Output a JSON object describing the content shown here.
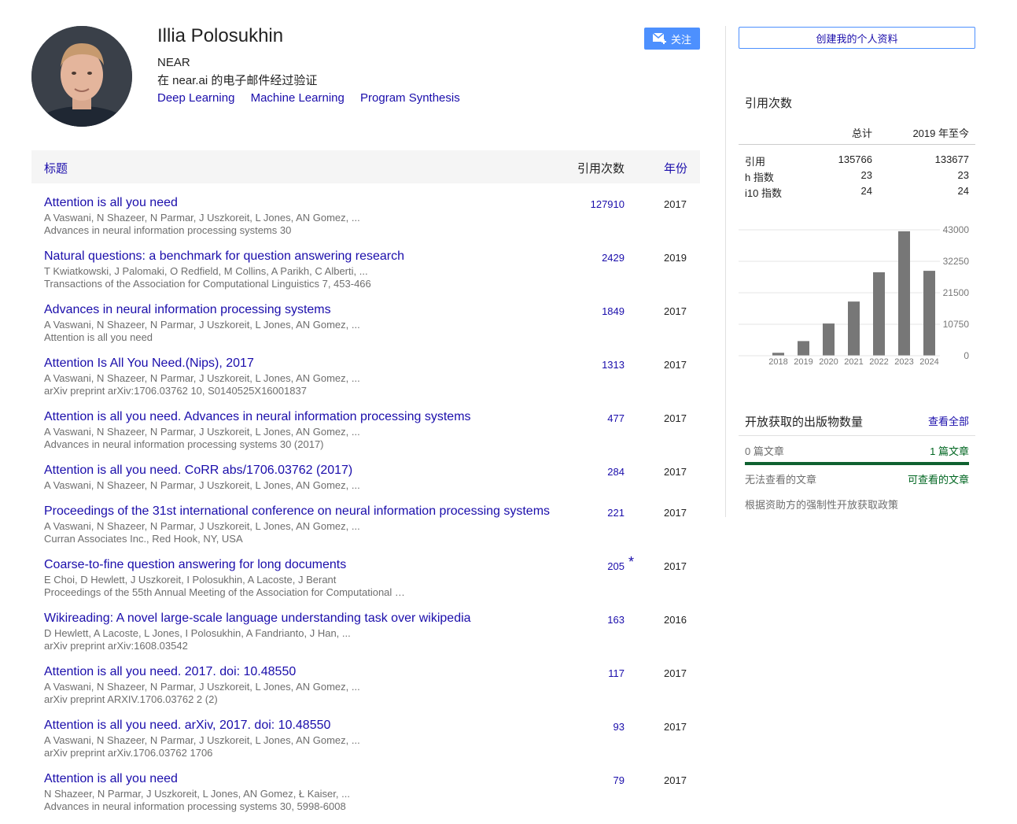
{
  "profile": {
    "name": "Illia Polosukhin",
    "affiliation": "NEAR",
    "email_verified": "在 near.ai 的电子邮件经过验证",
    "interests": [
      "Deep Learning",
      "Machine Learning",
      "Program Synthesis"
    ],
    "follow_label": "关注",
    "icons": {
      "follow": "mail-plus-icon",
      "avatar": "profile-photo"
    }
  },
  "table": {
    "header": {
      "title": "标题",
      "cites": "引用次数",
      "year": "年份"
    },
    "articles": [
      {
        "title": "Attention is all you need",
        "authors": "A Vaswani, N Shazeer, N Parmar, J Uszkoreit, L Jones, AN Gomez, ...",
        "venue": "Advances in neural information processing systems 30",
        "cites": "127910",
        "year": "2017",
        "star": ""
      },
      {
        "title": "Natural questions: a benchmark for question answering research",
        "authors": "T Kwiatkowski, J Palomaki, O Redfield, M Collins, A Parikh, C Alberti, ...",
        "venue": "Transactions of the Association for Computational Linguistics 7, 453-466",
        "cites": "2429",
        "year": "2019",
        "star": ""
      },
      {
        "title": "Advances in neural information processing systems",
        "authors": "A Vaswani, N Shazeer, N Parmar, J Uszkoreit, L Jones, AN Gomez, ...",
        "venue": "Attention is all you need",
        "cites": "1849",
        "year": "2017",
        "star": ""
      },
      {
        "title": "Attention Is All You Need.(Nips), 2017",
        "authors": "A Vaswani, N Shazeer, N Parmar, J Uszkoreit, L Jones, AN Gomez, ...",
        "venue": "arXiv preprint arXiv:1706.03762 10, S0140525X16001837",
        "cites": "1313",
        "year": "2017",
        "star": ""
      },
      {
        "title": "Attention is all you need. Advances in neural information processing systems",
        "authors": "A Vaswani, N Shazeer, N Parmar, J Uszkoreit, L Jones, AN Gomez, ...",
        "venue": "Advances in neural information processing systems 30 (2017)",
        "cites": "477",
        "year": "2017",
        "star": ""
      },
      {
        "title": "Attention is all you need. CoRR abs/1706.03762 (2017)",
        "authors": "A Vaswani, N Shazeer, N Parmar, J Uszkoreit, L Jones, AN Gomez, ...",
        "venue": "",
        "cites": "284",
        "year": "2017",
        "star": ""
      },
      {
        "title": "Proceedings of the 31st international conference on neural information processing systems",
        "authors": "A Vaswani, N Shazeer, N Parmar, J Uszkoreit, L Jones, AN Gomez, ...",
        "venue": "Curran Associates Inc., Red Hook, NY, USA",
        "cites": "221",
        "year": "2017",
        "star": ""
      },
      {
        "title": "Coarse-to-fine question answering for long documents",
        "authors": "E Choi, D Hewlett, J Uszkoreit, I Polosukhin, A Lacoste, J Berant",
        "venue": "Proceedings of the 55th Annual Meeting of the Association for Computational …",
        "cites": "205",
        "year": "2017",
        "star": "*"
      },
      {
        "title": "Wikireading: A novel large-scale language understanding task over wikipedia",
        "authors": "D Hewlett, A Lacoste, L Jones, I Polosukhin, A Fandrianto, J Han, ...",
        "venue": "arXiv preprint arXiv:1608.03542",
        "cites": "163",
        "year": "2016",
        "star": ""
      },
      {
        "title": "Attention is all you need. 2017. doi: 10.48550",
        "authors": "A Vaswani, N Shazeer, N Parmar, J Uszkoreit, L Jones, AN Gomez, ...",
        "venue": "arXiv preprint ARXIV.1706.03762 2 (2)",
        "cites": "117",
        "year": "2017",
        "star": ""
      },
      {
        "title": "Attention is all you need. arXiv, 2017. doi: 10.48550",
        "authors": "A Vaswani, N Shazeer, N Parmar, J Uszkoreit, L Jones, AN Gomez, ...",
        "venue": "arXiv preprint arXiv.1706.03762 1706",
        "cites": "93",
        "year": "2017",
        "star": ""
      },
      {
        "title": "Attention is all you need",
        "authors": "N Shazeer, N Parmar, J Uszkoreit, L Jones, AN Gomez, Ł Kaiser, ...",
        "venue": "Advances in neural information processing systems 30, 5998-6008",
        "cites": "79",
        "year": "2017",
        "star": ""
      }
    ]
  },
  "sidebar": {
    "create_profile": "创建我的个人资料",
    "cited_by_title": "引用次数",
    "stats_header": {
      "all": "总计",
      "since": "2019 年至今"
    },
    "stats": [
      {
        "label": "引用",
        "all": "135766",
        "since": "133677"
      },
      {
        "label": "h 指数",
        "all": "23",
        "since": "23"
      },
      {
        "label": "i10 指数",
        "all": "24",
        "since": "24"
      }
    ],
    "open_access": {
      "title": "开放获取的出版物数量",
      "view_all": "查看全部",
      "unavailable_count": "0 篇文章",
      "available_count": "1 篇文章",
      "unavailable_label": "无法查看的文章",
      "available_label": "可查看的文章",
      "note": "根据资助方的强制性开放获取政策",
      "available_fraction": 1.0
    }
  },
  "chart_data": {
    "type": "bar",
    "categories": [
      "2018",
      "2019",
      "2020",
      "2021",
      "2022",
      "2023",
      "2024"
    ],
    "values": [
      1000,
      5000,
      11000,
      18500,
      28500,
      42500,
      29000
    ],
    "yticks": [
      "43000",
      "32250",
      "21500",
      "10750",
      "0"
    ],
    "ylim": [
      0,
      43000
    ],
    "grid": true,
    "bar_color": "#777777",
    "title": "",
    "xlabel": "",
    "ylabel": ""
  },
  "colors": {
    "link": "#1a0dab",
    "accent": "#4d90fe",
    "meta": "#6e6e6e",
    "oa_green": "#0f6130"
  }
}
